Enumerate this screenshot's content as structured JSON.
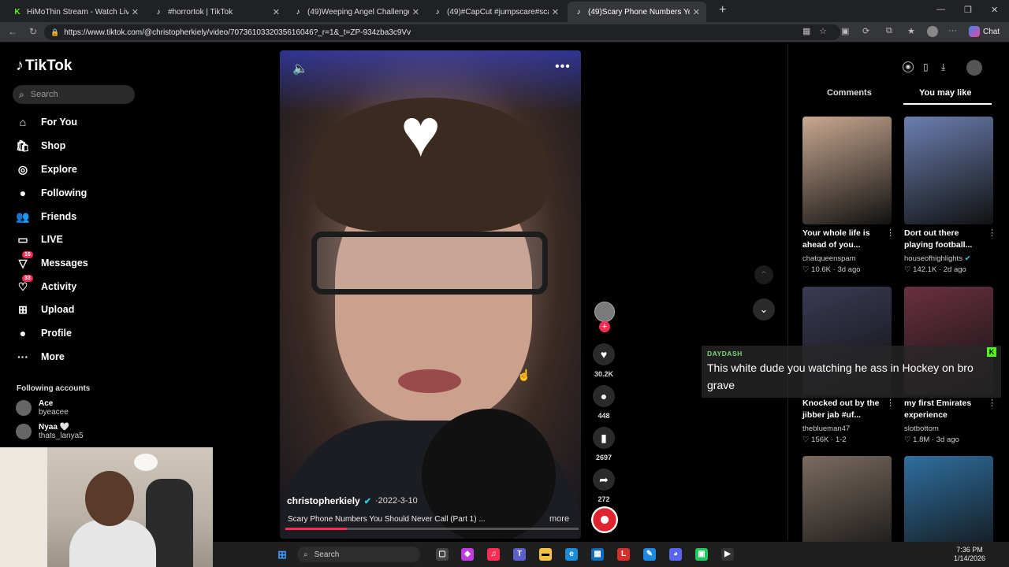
{
  "browser": {
    "tabs": [
      {
        "title": "HiMoThin Stream - Watch Live on",
        "fav": "K",
        "color": "#53fc18",
        "active": false
      },
      {
        "title": "#horrortok | TikTok",
        "fav": "♪",
        "color": "#ffffff",
        "active": false
      },
      {
        "title": "(49)Weeping Angel Challenge for",
        "fav": "♪",
        "color": "#ffffff",
        "active": false
      },
      {
        "title": "(49)#CapCut #jumpscare#scary#s",
        "fav": "♪",
        "color": "#ffffff",
        "active": false
      },
      {
        "title": "(49)Scary Phone Numbers You Sh",
        "fav": "♪",
        "color": "#ffffff",
        "active": true
      }
    ],
    "url": "https://www.tiktok.com/@christopherkiely/video/7073610332035616046?_r=1&_t=ZP-934zba3c9Vv",
    "chat_label": "Chat"
  },
  "sidebar": {
    "logo": "TikTok",
    "search_placeholder": "Search",
    "items": [
      {
        "label": "For You",
        "icon": "home-icon",
        "glyph": "⌂"
      },
      {
        "label": "Shop",
        "icon": "shop-icon",
        "glyph": "🛍"
      },
      {
        "label": "Explore",
        "icon": "compass-icon",
        "glyph": "◎"
      },
      {
        "label": "Following",
        "icon": "following-avatar-icon",
        "glyph": "●"
      },
      {
        "label": "Friends",
        "icon": "friends-icon",
        "glyph": "👥"
      },
      {
        "label": "LIVE",
        "icon": "live-icon",
        "glyph": "▭"
      },
      {
        "label": "Messages",
        "icon": "messages-icon",
        "glyph": "▽",
        "badge": "16"
      },
      {
        "label": "Activity",
        "icon": "activity-icon",
        "glyph": "♡",
        "badge": "33"
      },
      {
        "label": "Upload",
        "icon": "upload-icon",
        "glyph": "⊞"
      },
      {
        "label": "Profile",
        "icon": "profile-icon",
        "glyph": "●"
      },
      {
        "label": "More",
        "icon": "more-icon",
        "glyph": "···"
      }
    ],
    "following_heading": "Following accounts",
    "accounts": [
      {
        "name": "Ace",
        "handle": "byeacee"
      },
      {
        "name": "Nyaa 🤍",
        "handle": "thats_lanya5"
      }
    ]
  },
  "video": {
    "author": "christopherkiely",
    "date": "2022-3-10",
    "caption": "Scary Phone Numbers You Should Never Call (Part 1) ...",
    "more": "more",
    "progress": 0.21,
    "likes": "30.2K",
    "comments": "448",
    "saves": "2697",
    "shares": "272"
  },
  "right_panel": {
    "tab_comments": "Comments",
    "tab_you_may_like": "You may like",
    "cards": [
      {
        "title": "Your whole life is ahead of you...",
        "author": "chatqueenspam",
        "likes": "10.6K",
        "age": "3d ago",
        "verified": false,
        "bg": "#c9a890"
      },
      {
        "title": "Dort out there playing football...",
        "author": "houseofhighlights",
        "likes": "142.1K",
        "age": "2d ago",
        "verified": true,
        "bg": "#6b7fb0"
      },
      {
        "title": "Knocked out by the jibber jab #uf...",
        "author": "theblueman47",
        "likes": "156K",
        "age": "1-2",
        "verified": false,
        "bg": "#3a3a55"
      },
      {
        "title": "my first Emirates experience",
        "author": "slotbottom",
        "likes": "1.8M",
        "age": "3d ago",
        "verified": false,
        "bg": "#6a3040"
      },
      {
        "title": "",
        "author": "",
        "likes": "",
        "age": "",
        "verified": false,
        "bg": "#7a6b60"
      },
      {
        "title": "",
        "author": "",
        "likes": "",
        "age": "",
        "verified": false,
        "bg": "#2f6f9f"
      }
    ]
  },
  "overlay": {
    "label": "DAYDASH",
    "text": "This white dude you watching he ass in Hockey on bro grave"
  },
  "taskbar": {
    "search": "Search",
    "time": "7:36 PM",
    "date": "1/14/2026"
  }
}
